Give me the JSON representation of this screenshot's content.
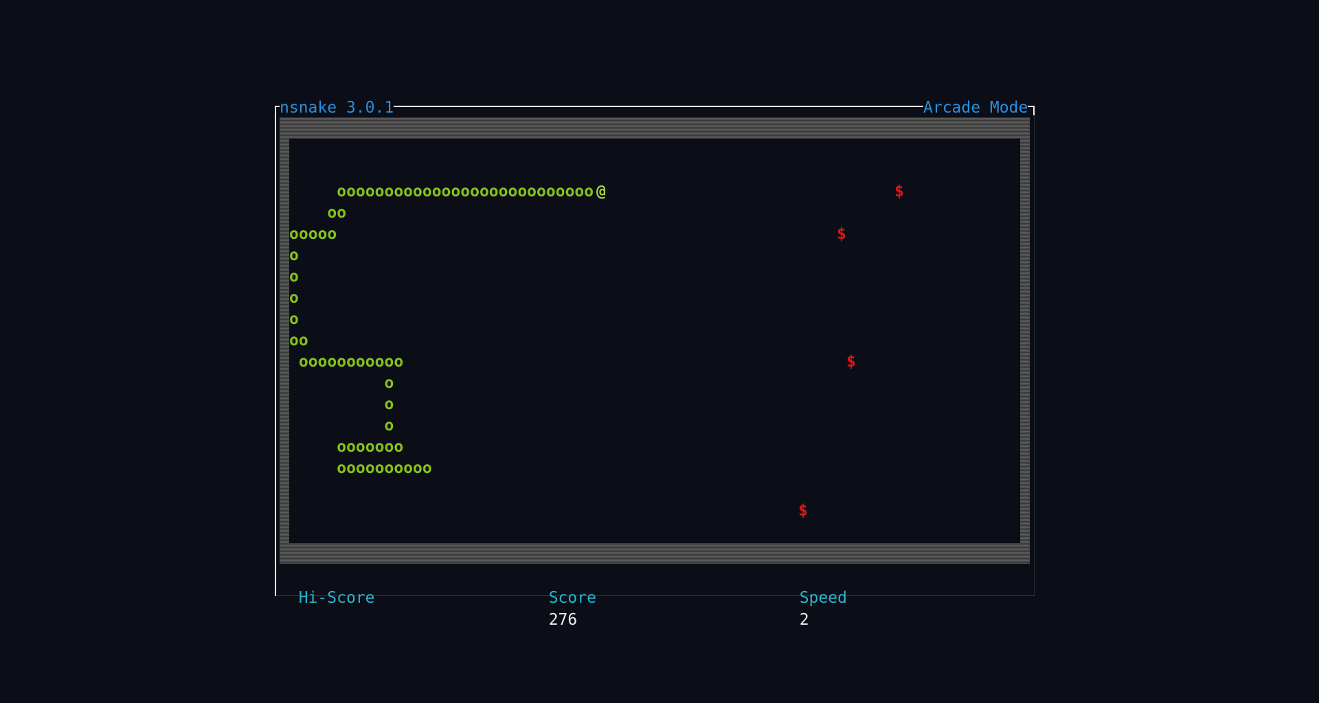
{
  "window": {
    "title_left": "nsnake 3.0.1",
    "title_right": "Arcade Mode"
  },
  "board": {
    "snake_rows": [
      "     ooooooooooooooooooooooooooo",
      "    oo",
      "ooooo",
      "o",
      "o",
      "o",
      "o",
      "oo",
      " ooooooooooo",
      "          o",
      "          o",
      "          o",
      "     ooooooo",
      "     oooooooooo"
    ],
    "head_glyph": "@",
    "fruit_glyph": "$",
    "snake_color": "#86c21a",
    "fruit_color": "#e0161c",
    "fruit_count": 4
  },
  "status_bar": {
    "hiscore_label": "Hi-Score",
    "hiscore_value": "",
    "score_label": "Score",
    "score_value": "276",
    "speed_label": "Speed",
    "speed_value": "2"
  },
  "colors": {
    "background": "#0b0e16",
    "title": "#2a8fe0",
    "label": "#29b4cf"
  }
}
